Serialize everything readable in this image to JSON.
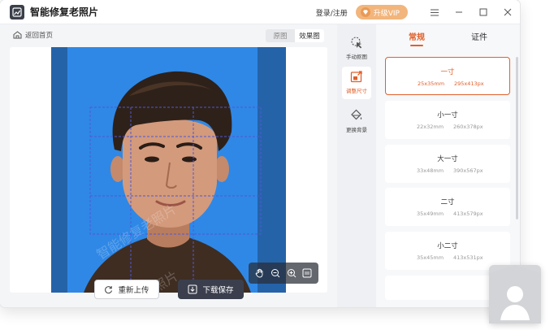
{
  "app": {
    "title": "智能修复老照片"
  },
  "header": {
    "login_label": "登录/注册",
    "vip_label": "升级VIP"
  },
  "left": {
    "back_home_label": "返回首页",
    "view_toggle": {
      "original": "原图",
      "effect": "效果图"
    },
    "watermark": "智能修复老照片",
    "buttons": {
      "reupload": "重新上传",
      "download": "下载保存"
    }
  },
  "tools": [
    {
      "label": "手动抠图",
      "icon": "cursor-magic-icon"
    },
    {
      "label": "调整尺寸",
      "icon": "resize-icon"
    },
    {
      "label": "更换背景",
      "icon": "bucket-icon"
    }
  ],
  "right": {
    "tabs": [
      "常规",
      "证件"
    ],
    "sizes": [
      {
        "name": "一寸",
        "mm": "25x35mm",
        "px": "295x413px"
      },
      {
        "name": "小一寸",
        "mm": "22x32mm",
        "px": "260x378px"
      },
      {
        "name": "大一寸",
        "mm": "33x48mm",
        "px": "390x567px"
      },
      {
        "name": "二寸",
        "mm": "35x49mm",
        "px": "413x579px"
      },
      {
        "name": "小二寸",
        "mm": "35x45mm",
        "px": "413x531px"
      }
    ]
  },
  "colors": {
    "accent": "#e0602a",
    "photo_bg": "#2f88e6",
    "vip": "#f2b57c",
    "download_btn": "#3b3f4d"
  }
}
